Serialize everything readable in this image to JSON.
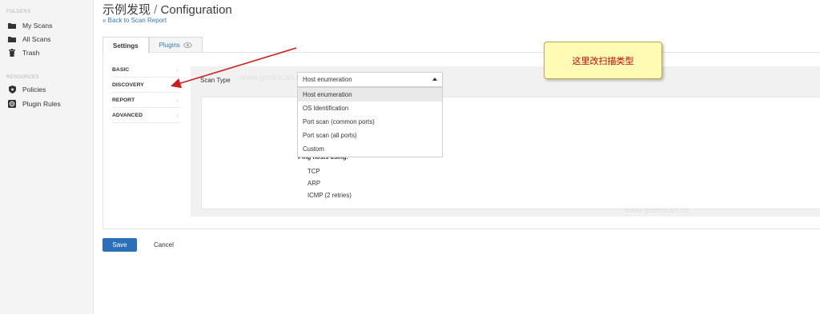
{
  "sidebar": {
    "folders_label": "FOLDERS",
    "folders": [
      {
        "label": "My Scans",
        "icon": "folder-icon"
      },
      {
        "label": "All Scans",
        "icon": "folder-icon"
      },
      {
        "label": "Trash",
        "icon": "trash-icon"
      }
    ],
    "resources_label": "RESOURCES",
    "resources": [
      {
        "label": "Policies",
        "icon": "shield-icon"
      },
      {
        "label": "Plugin Rules",
        "icon": "plugin-rules-icon"
      }
    ]
  },
  "header": {
    "title_main": "示例发现",
    "title_sep": " / ",
    "title_sub": "Configuration",
    "back_link": "« Back to Scan Report"
  },
  "tabs": [
    {
      "label": "Settings",
      "active": true
    },
    {
      "label": "Plugins",
      "active": false,
      "icon": "eye-icon"
    }
  ],
  "settings_nav": [
    {
      "label": "BASIC"
    },
    {
      "label": "DISCOVERY"
    },
    {
      "label": "REPORT"
    },
    {
      "label": "ADVANCED"
    }
  ],
  "scan_type": {
    "label": "Scan Type",
    "selected": "Host enumeration",
    "options": [
      "Host enumeration",
      "OS Identification",
      "Port scan (common ports)",
      "Port scan (all ports)",
      "Custom"
    ]
  },
  "ping": {
    "heading": "Ping hosts using:",
    "methods": [
      "TCP",
      "ARP",
      "ICMP (2 retries)"
    ]
  },
  "annotation": {
    "text": "这里改扫描类型",
    "color": "#c00000"
  },
  "watermark": "www.geekscan.cn",
  "footer": {
    "save_label": "Save",
    "cancel_label": "Cancel"
  },
  "colors": {
    "accent": "#2a6fb7",
    "link": "#2e7bbd",
    "callout_bg": "#fffbb4"
  }
}
